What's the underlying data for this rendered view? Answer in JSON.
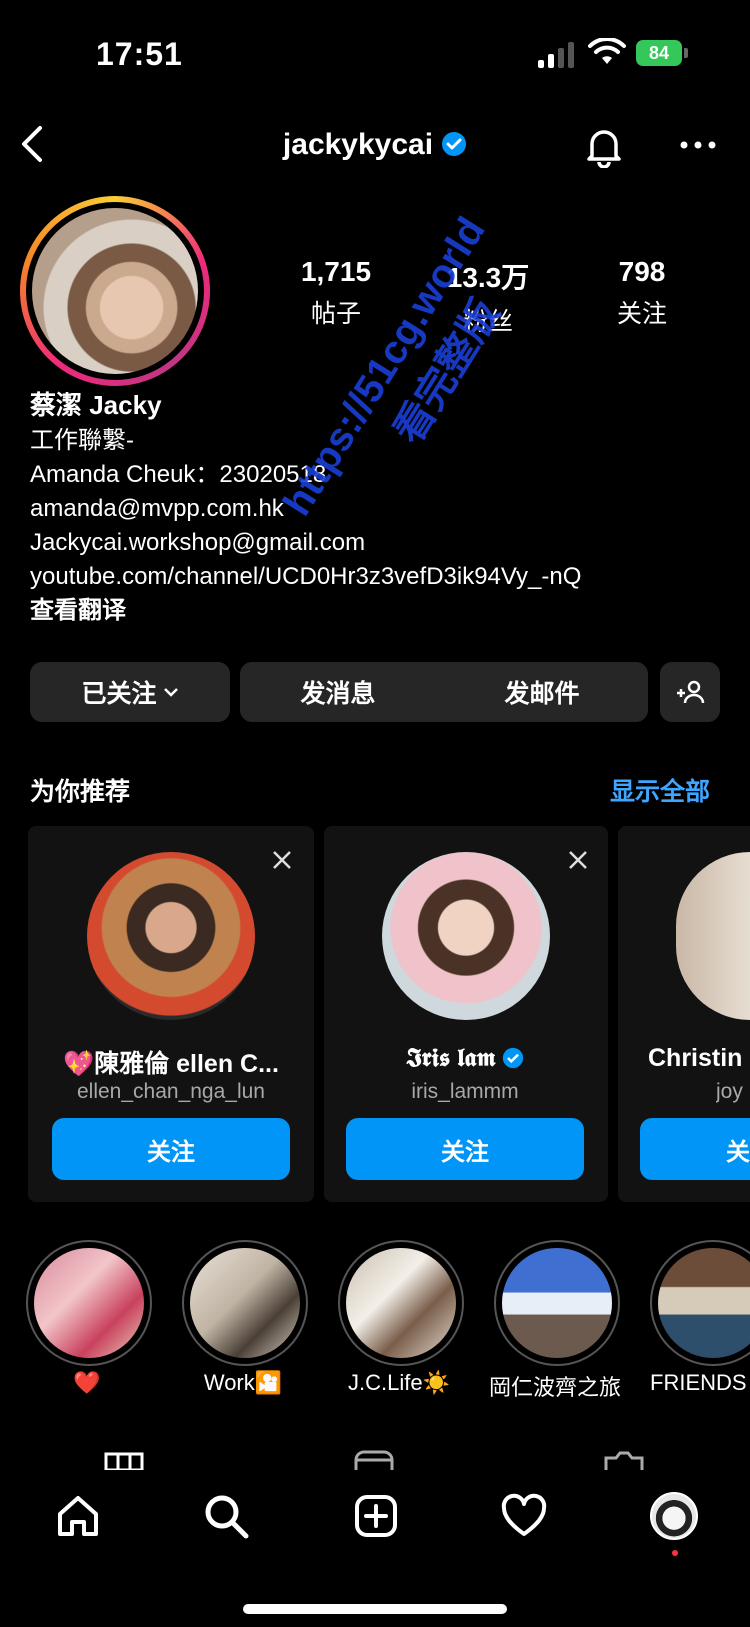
{
  "status_bar": {
    "time": "17:51",
    "battery": "84"
  },
  "header": {
    "username": "jackykycai"
  },
  "stats": [
    {
      "value": "1,715",
      "label": "帖子"
    },
    {
      "value": "13.3万",
      "label": "粉丝"
    },
    {
      "value": "798",
      "label": "关注"
    }
  ],
  "bio": {
    "name": "蔡潔 Jacky",
    "lines": [
      "工作聯繫-",
      "Amanda Cheuk：23020518",
      "amanda@mvpp.com.hk",
      "Jackycai.workshop@gmail.com",
      "youtube.com/channel/UCD0Hr3z3vefD3ik94Vy_-nQ"
    ],
    "translate": "查看翻译"
  },
  "actions": {
    "following": "已关注",
    "message": "发消息",
    "email": "发邮件"
  },
  "suggestions": {
    "title": "为你推荐",
    "see_all": "显示全部",
    "cards": [
      {
        "name": "💖陳雅倫 ellen C...",
        "handle": "ellen_chan_nga_lun",
        "follow": "关注"
      },
      {
        "name": "𝕴𝖗𝖎𝖘 𝖑𝖆𝖒",
        "handle": "iris_lammm",
        "follow": "关注"
      },
      {
        "name": "Christin",
        "handle": "joy",
        "follow": "关"
      }
    ]
  },
  "highlights": [
    {
      "label": "❤️"
    },
    {
      "label": "Work🎦"
    },
    {
      "label": "J.C.Life☀️"
    },
    {
      "label": "岡仁波齊之旅"
    },
    {
      "label": "FRIENDS"
    }
  ],
  "watermark": {
    "line1": "https://51cg.world",
    "line2": "看完整版"
  },
  "colors": {
    "accent": "#0095f6",
    "link": "#3ea6ff",
    "battery": "#34c759"
  }
}
